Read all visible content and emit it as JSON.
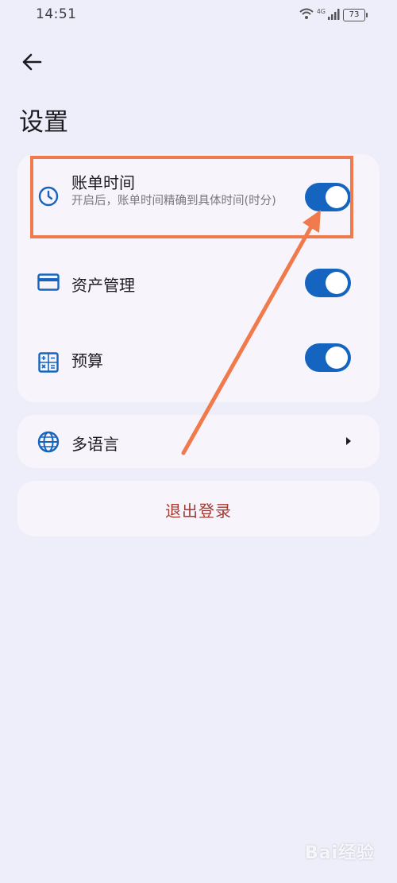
{
  "status_bar": {
    "time": "14:51",
    "network": "4G",
    "battery": "73"
  },
  "header": {
    "title": "设置"
  },
  "settings": {
    "items": [
      {
        "label": "账单时间",
        "subtitle": "开启后，账单时间精确到具体时间(时分)",
        "icon": "clock-icon",
        "enabled": true
      },
      {
        "label": "资产管理",
        "icon": "credit-card-icon",
        "enabled": true
      },
      {
        "label": "预算",
        "icon": "calculator-icon",
        "enabled": true
      }
    ]
  },
  "language": {
    "label": "多语言",
    "icon": "globe-icon"
  },
  "logout": {
    "label": "退出登录"
  },
  "watermark": {
    "text": "Bai经验"
  },
  "colors": {
    "background": "#eeeefa",
    "card": "#f8f4fb",
    "accent": "#1565c0",
    "logout": "#a33a32",
    "annotation": "#f07a4b"
  }
}
